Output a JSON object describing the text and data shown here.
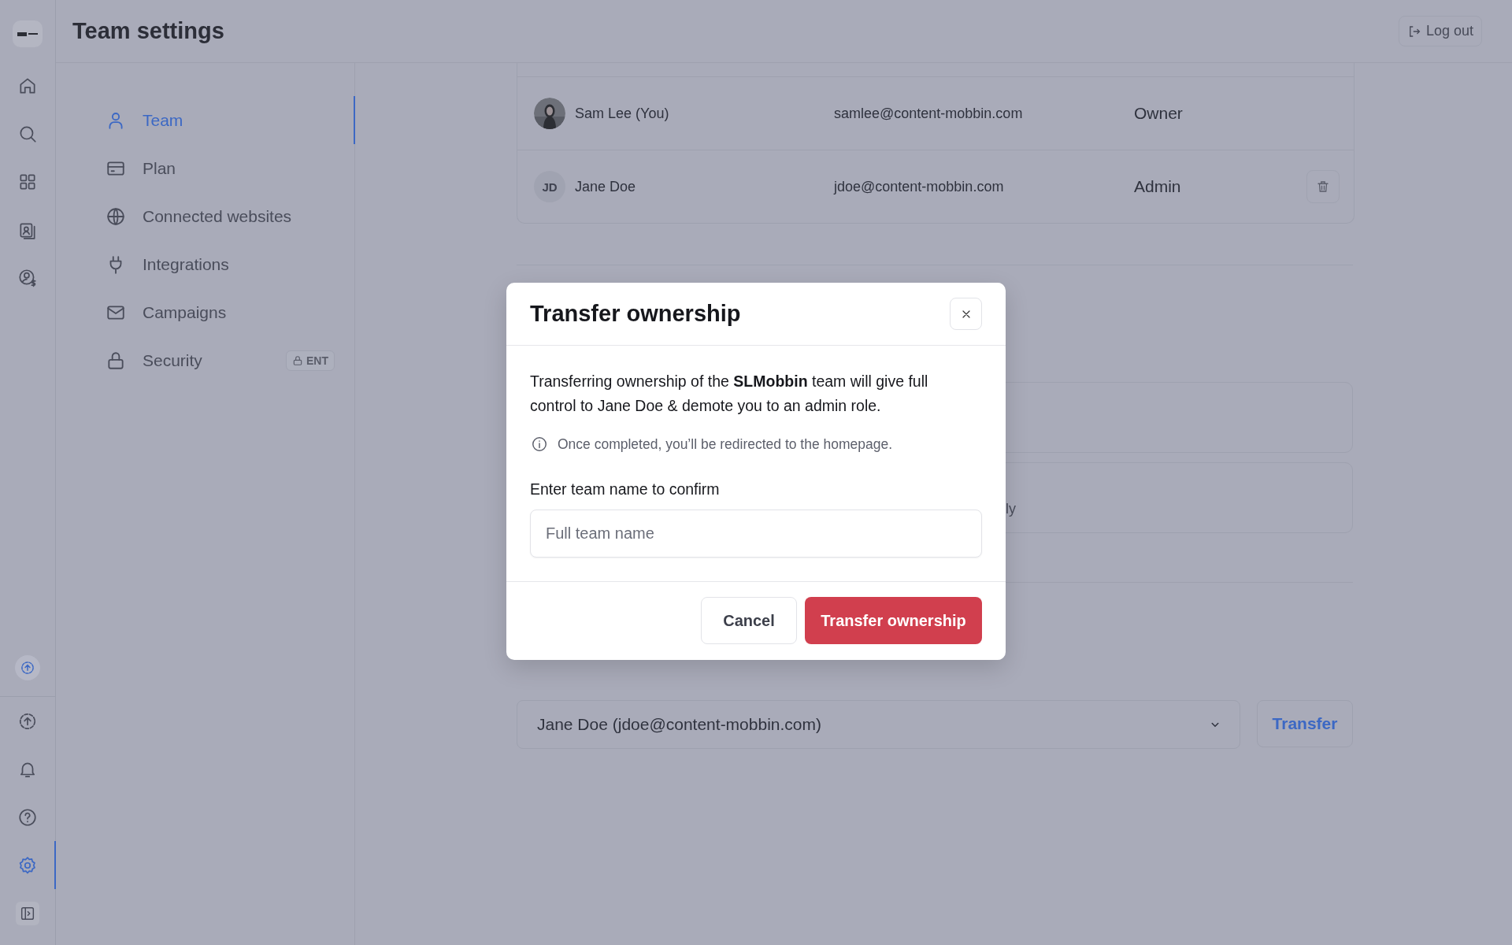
{
  "header": {
    "title": "Team settings",
    "logout": "Log out"
  },
  "rail": {
    "top": [
      {
        "kind": "home",
        "selected": false
      },
      {
        "kind": "search",
        "selected": false
      },
      {
        "kind": "grid",
        "selected": false
      },
      {
        "kind": "contacts",
        "selected": false
      },
      {
        "kind": "billing",
        "selected": false
      }
    ],
    "bottom": [
      {
        "kind": "upload",
        "selected": false
      },
      {
        "kind": "bell",
        "selected": false
      },
      {
        "kind": "help",
        "selected": false
      },
      {
        "kind": "gear",
        "selected": true
      },
      {
        "kind": "panel",
        "selected": false
      }
    ]
  },
  "nav": [
    {
      "label": "Team",
      "kind": "user",
      "selected": true
    },
    {
      "label": "Plan",
      "kind": "card",
      "selected": false
    },
    {
      "label": "Connected websites",
      "kind": "globe",
      "selected": false
    },
    {
      "label": "Integrations",
      "kind": "plug",
      "selected": false
    },
    {
      "label": "Campaigns",
      "kind": "mail",
      "selected": false
    },
    {
      "label": "Security",
      "kind": "lock",
      "selected": false,
      "badge": "ENT"
    }
  ],
  "members": [
    {
      "name": "Sam Lee (You)",
      "email": "samlee@content-mobbin.com",
      "role": "Owner",
      "removable": false
    },
    {
      "name": "Jane Doe",
      "initials": "JD",
      "email": "jdoe@content-mobbin.com",
      "role": "Admin",
      "removable": true
    }
  ],
  "partial_card": {
    "text": "ly"
  },
  "transfer": {
    "select_value": "Jane Doe (jdoe@content-mobbin.com)",
    "button": "Transfer"
  },
  "modal": {
    "title": "Transfer ownership",
    "message": "Transferring ownership of the **SLMobbin** team will give full control to Jane Doe & demote you to an admin role.",
    "note": "Once completed, you’ll be redirected to the homepage.",
    "field_label": "Enter team name to confirm",
    "placeholder": "Full team name",
    "cancel": "Cancel",
    "confirm": "Transfer ownership"
  }
}
